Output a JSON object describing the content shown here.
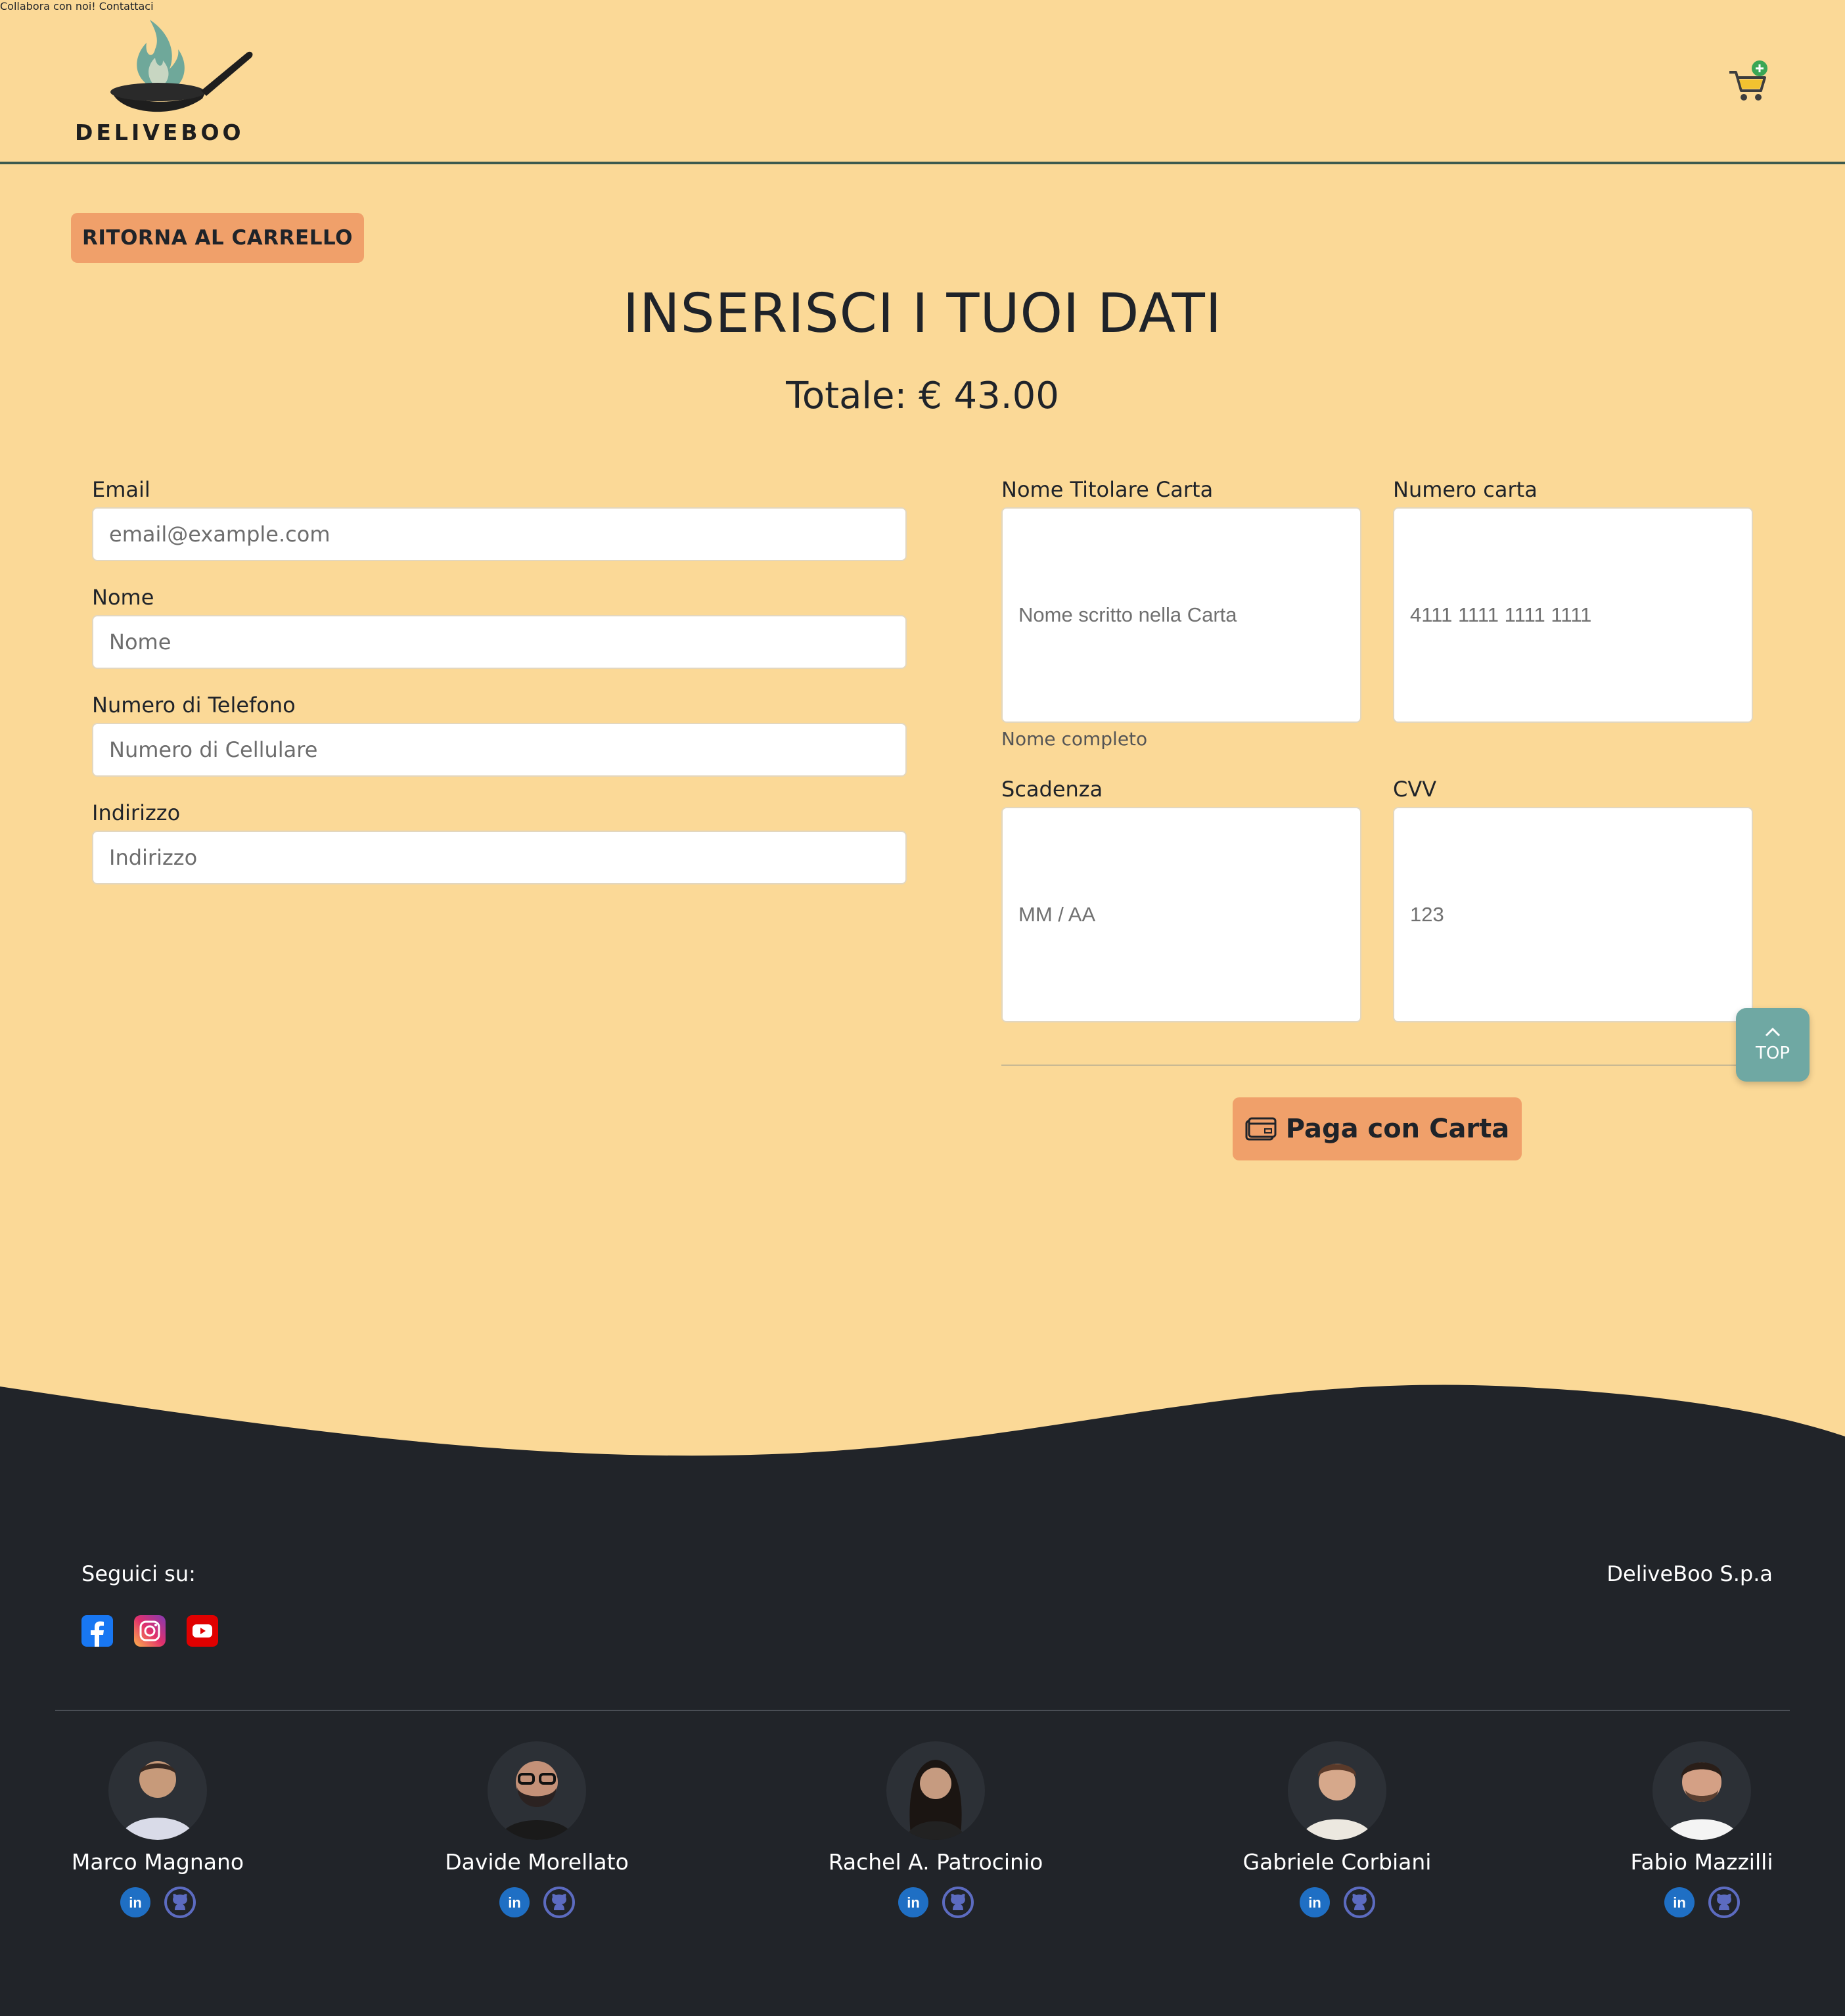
{
  "header": {
    "logo_text": "DELIVEBOO",
    "nav": [
      {
        "label": "Collabora con noi!"
      },
      {
        "label": "Contattaci"
      }
    ]
  },
  "back_button": "RITORNA AL CARRELLO",
  "title": "INSERISCI I TUOI DATI",
  "total": "Totale: € 43.00",
  "customer_form": {
    "email": {
      "label": "Email",
      "placeholder": "email@example.com"
    },
    "name": {
      "label": "Nome",
      "placeholder": "Nome"
    },
    "phone": {
      "label": "Numero di Telefono",
      "placeholder": "Numero di Cellulare"
    },
    "address": {
      "label": "Indirizzo",
      "placeholder": "Indirizzo"
    }
  },
  "payment_form": {
    "cardholder": {
      "label": "Nome Titolare Carta",
      "placeholder": "Nome scritto nella Carta",
      "hint": "Nome completo"
    },
    "card_number": {
      "label": "Numero carta",
      "placeholder": "4111 1111 1111 1111"
    },
    "expiry": {
      "label": "Scadenza",
      "placeholder": "MM / AA"
    },
    "cvv": {
      "label": "CVV",
      "placeholder": "123"
    },
    "pay_button": "Paga con Carta"
  },
  "top_button": "TOP",
  "footer": {
    "follow_label": "Seguici su:",
    "company": "DeliveBoo S.p.a",
    "social_icons": [
      "facebook-icon",
      "instagram-icon",
      "youtube-icon"
    ],
    "team": [
      {
        "name": "Marco Magnano"
      },
      {
        "name": "Davide Morellato"
      },
      {
        "name": "Rachel A. Patrocinio"
      },
      {
        "name": "Gabriele Corbiani"
      },
      {
        "name": "Fabio Mazzilli"
      }
    ]
  },
  "colors": {
    "background": "#fbd997",
    "accent": "#f0a06a",
    "nav_text": "#3d5a45",
    "footer": "#212429",
    "top_button": "#6fa8a3"
  }
}
